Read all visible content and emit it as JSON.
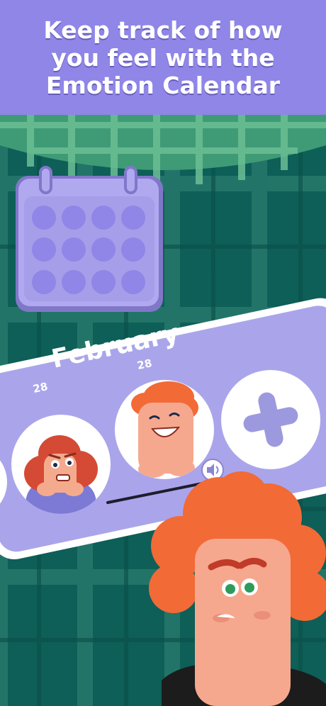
{
  "header": {
    "title_lines": [
      "Keep track of how",
      "you feel with the",
      "Emotion Calendar"
    ]
  },
  "calendar_card": {
    "month": "February",
    "entries": [
      {
        "date": "28",
        "emotion": "anxious"
      },
      {
        "date": "28",
        "emotion": "happy"
      }
    ],
    "add_button_symbol": "+"
  },
  "colors": {
    "header_bg": "#8f86e7",
    "card_bg": "#aaa5ea",
    "background_teal": "#0d5f58",
    "tablecloth_green": "#3f9b76",
    "character_hair": "#f26a36",
    "character_skin": "#f6a88e"
  },
  "icons": {
    "add": "plus-icon",
    "audio": "speaker-icon",
    "calendar": "calendar-icon"
  }
}
